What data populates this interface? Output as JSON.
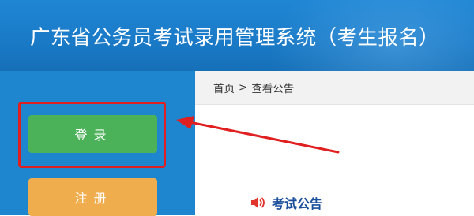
{
  "header": {
    "title": "广东省公务员考试录用管理系统（考生报名）"
  },
  "sidebar": {
    "login_label": "登录",
    "register_label": "注册"
  },
  "breadcrumb": {
    "home": "首页",
    "separator": ">",
    "current": "查看公告"
  },
  "main": {
    "notice_heading": "考试公告",
    "notice_icon": "speaker-icon"
  },
  "annotation": {
    "highlight_color": "#e02020",
    "pointer": "red-arrow"
  },
  "colors": {
    "header_blue": "#1a7bc8",
    "sidebar_blue": "#1e85cf",
    "login_green": "#4cb25a",
    "register_orange": "#f0ad4e",
    "notice_text": "#1a4f9c"
  }
}
